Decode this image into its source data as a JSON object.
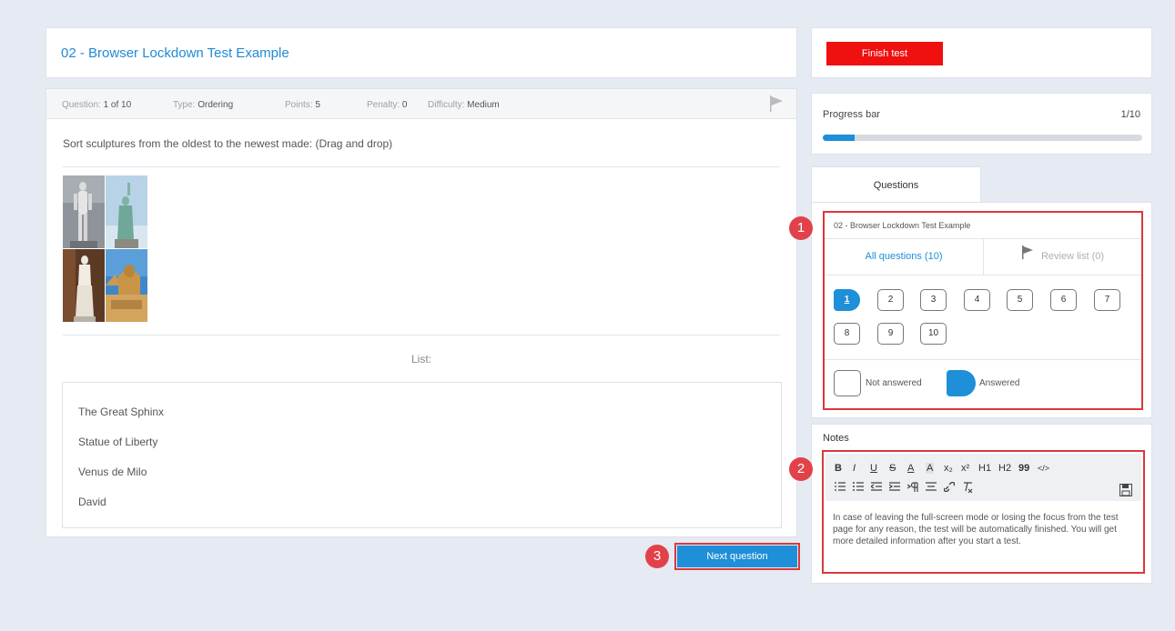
{
  "test": {
    "title": "02 - Browser Lockdown Test Example"
  },
  "meta": {
    "question_label": "Question:",
    "question_value": "1 of 10",
    "type_label": "Type:",
    "type_value": "Ordering",
    "points_label": "Points:",
    "points_value": "5",
    "penalty_label": "Penalty:",
    "penalty_value": "0",
    "difficulty_label": "Difficulty:",
    "difficulty_value": "Medium"
  },
  "question": {
    "text": "Sort sculptures from the oldest to the newest made: (Drag and drop)",
    "list_label": "List:",
    "items": [
      "The Great Sphinx",
      "Statue of Liberty",
      "Venus de Milo",
      "David"
    ]
  },
  "buttons": {
    "next": "Next question",
    "finish": "Finish test"
  },
  "progress": {
    "label": "Progress bar",
    "value_text": "1/10",
    "fraction": 0.1
  },
  "questions_panel": {
    "tab_label": "Questions",
    "title": "02 - Browser Lockdown Test Example",
    "all_tab": "All questions (10)",
    "review_tab": "Review list (0)",
    "numbers": [
      "1",
      "2",
      "3",
      "4",
      "5",
      "6",
      "7",
      "8",
      "9",
      "10"
    ],
    "answered": [
      "1"
    ],
    "legend_not_answered": "Not answered",
    "legend_answered": "Answered"
  },
  "notes": {
    "title": "Notes",
    "toolbar_row1": [
      "B",
      "I",
      "U",
      "S",
      "A",
      "A",
      "x₂",
      "x²",
      "H1",
      "H2",
      "99",
      "</>"
    ],
    "toolbar_row2_icons": [
      "ordered-list-icon",
      "bullet-list-icon",
      "outdent-icon",
      "indent-icon",
      "paragraph-icon",
      "align-icon",
      "link-icon",
      "clear-format-icon"
    ],
    "text": "In case of leaving the full-screen mode or losing the focus from the test page for any reason, the test will be automatically finished. You will get more detailed information after you start a test."
  },
  "annotations": [
    "1",
    "2",
    "3"
  ],
  "colors": {
    "accent": "#1e8fd8",
    "finish": "#f01010",
    "annotation": "#d9393c",
    "background": "#e6eaf2"
  }
}
